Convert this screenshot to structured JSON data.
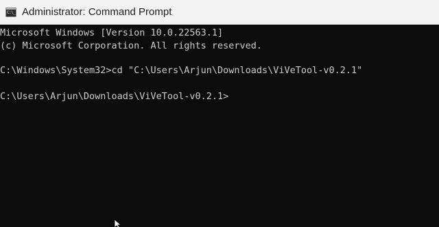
{
  "window": {
    "title": "Administrator: Command Prompt",
    "icon_name": "cmd-icon",
    "icon_glyph": "C:\\_"
  },
  "console": {
    "lines": [
      "Microsoft Windows [Version 10.0.22563.1]",
      "(c) Microsoft Corporation. All rights reserved.",
      "",
      "C:\\Windows\\System32>cd \"C:\\Users\\Arjun\\Downloads\\ViVeTool-v0.2.1\"",
      "",
      "C:\\Users\\Arjun\\Downloads\\ViVeTool-v0.2.1>"
    ]
  },
  "colors": {
    "titlebar_bg": "#f3f3f3",
    "console_bg": "#0c0c0c",
    "console_text": "#cccccc"
  }
}
